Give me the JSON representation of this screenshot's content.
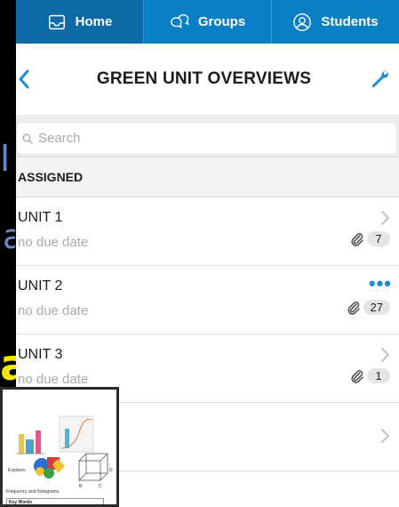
{
  "tabs": [
    {
      "label": "Home",
      "icon": "inbox-icon",
      "active": true
    },
    {
      "label": "Groups",
      "icon": "chat-bubbles-icon",
      "active": false
    },
    {
      "label": "Students",
      "icon": "person-icon",
      "active": false
    }
  ],
  "header": {
    "title": "GREEN UNIT OVERVIEWS"
  },
  "search": {
    "placeholder": "Search"
  },
  "section": {
    "label": "ASSIGNED"
  },
  "units": [
    {
      "title": "UNIT 1",
      "subtitle": "no due date",
      "attachments": "7",
      "action": "chevron"
    },
    {
      "title": "UNIT 2",
      "subtitle": "no due date",
      "attachments": "27",
      "action": "more"
    },
    {
      "title": "UNIT 3",
      "subtitle": "no due date",
      "attachments": "1",
      "action": "chevron"
    }
  ],
  "thumbnail": {
    "captions": [
      "Explores.",
      "Frequency and histograms."
    ],
    "key_words_title": "Key Words"
  },
  "colors": {
    "tab_bar": "#0a7fc4",
    "tab_active": "#0d6aa6",
    "accent": "#1b8ed0"
  }
}
